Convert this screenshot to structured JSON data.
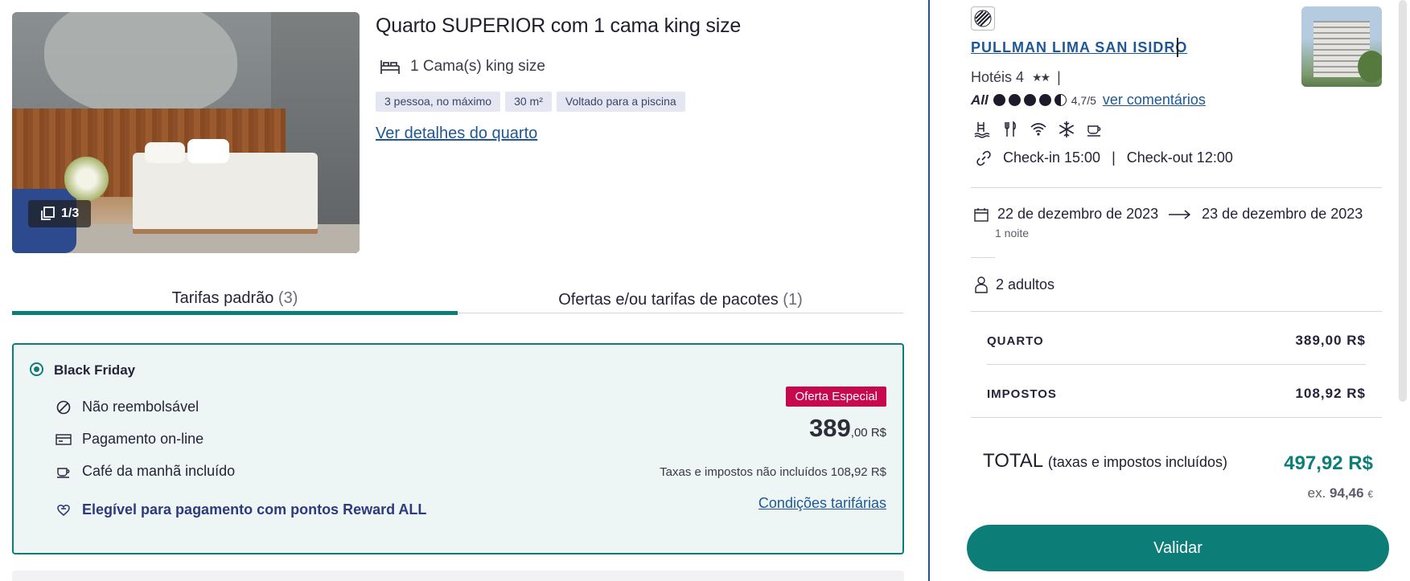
{
  "room": {
    "photo_counter": "1/3",
    "title": "Quarto SUPERIOR com 1 cama king size",
    "bed": "1 Cama(s) king size",
    "tags": [
      "3 pessoa, no máximo",
      "30 m²",
      "Voltado para a piscina"
    ],
    "details_link": "Ver detalhes do quarto"
  },
  "tabs": {
    "standard": {
      "label": "Tarifas padrão",
      "count": "(3)"
    },
    "offers": {
      "label": "Ofertas e/ou tarifas de pacotes",
      "count": "(1)"
    }
  },
  "rate": {
    "name": "Black Friday",
    "conditions": [
      "Não reembolsável",
      "Pagamento on-line",
      "Café da manhã incluído"
    ],
    "reward": "Elegível para pagamento com pontos Reward ALL",
    "badge": "Oferta Especial",
    "price_int": "389",
    "price_dec": ",00 R$",
    "tax_note_prefix": "Taxas e impostos não incluídos 108",
    "tax_note_bold": ",",
    "tax_note_suffix": "92 R$",
    "conditions_link": "Condições tarifárias"
  },
  "hotel": {
    "name": "PULLMAN LIMA SAN ISIDRO",
    "category": "Hotéis 4",
    "category_stars": "★★",
    "category_sep": "|",
    "rating_brand": "All",
    "rating_value": 4.7,
    "rating_text": "4,7/5",
    "reviews_link": "ver comentários",
    "amenities": [
      "pool-icon",
      "restaurant-icon",
      "wifi-icon",
      "air-conditioning-icon",
      "breakfast-icon"
    ],
    "checkin": "Check-in 15:00",
    "checkout": "Check-out 12:00",
    "checkin_sep": "|"
  },
  "stay": {
    "from": "22 de dezembro de 2023",
    "to": "23 de dezembro de 2023",
    "nights": "1 noite",
    "guests": "2 adultos"
  },
  "summary": {
    "room_label": "QUARTO",
    "room_value": "389,00 R$",
    "taxes_label": "IMPOSTOS",
    "taxes_value": "108,92 R$",
    "total_label": "TOTAL",
    "total_note": "(taxas e impostos incluídos)",
    "total_value": "497,92 R$",
    "ex_prefix": "ex.",
    "ex_value": "94,46",
    "ex_currency": "€",
    "validate_button": "Validar"
  },
  "colors": {
    "accent": "#0d7d78",
    "link": "#1f5795",
    "badge": "#c7084c",
    "card_bg": "#eef6f5"
  }
}
